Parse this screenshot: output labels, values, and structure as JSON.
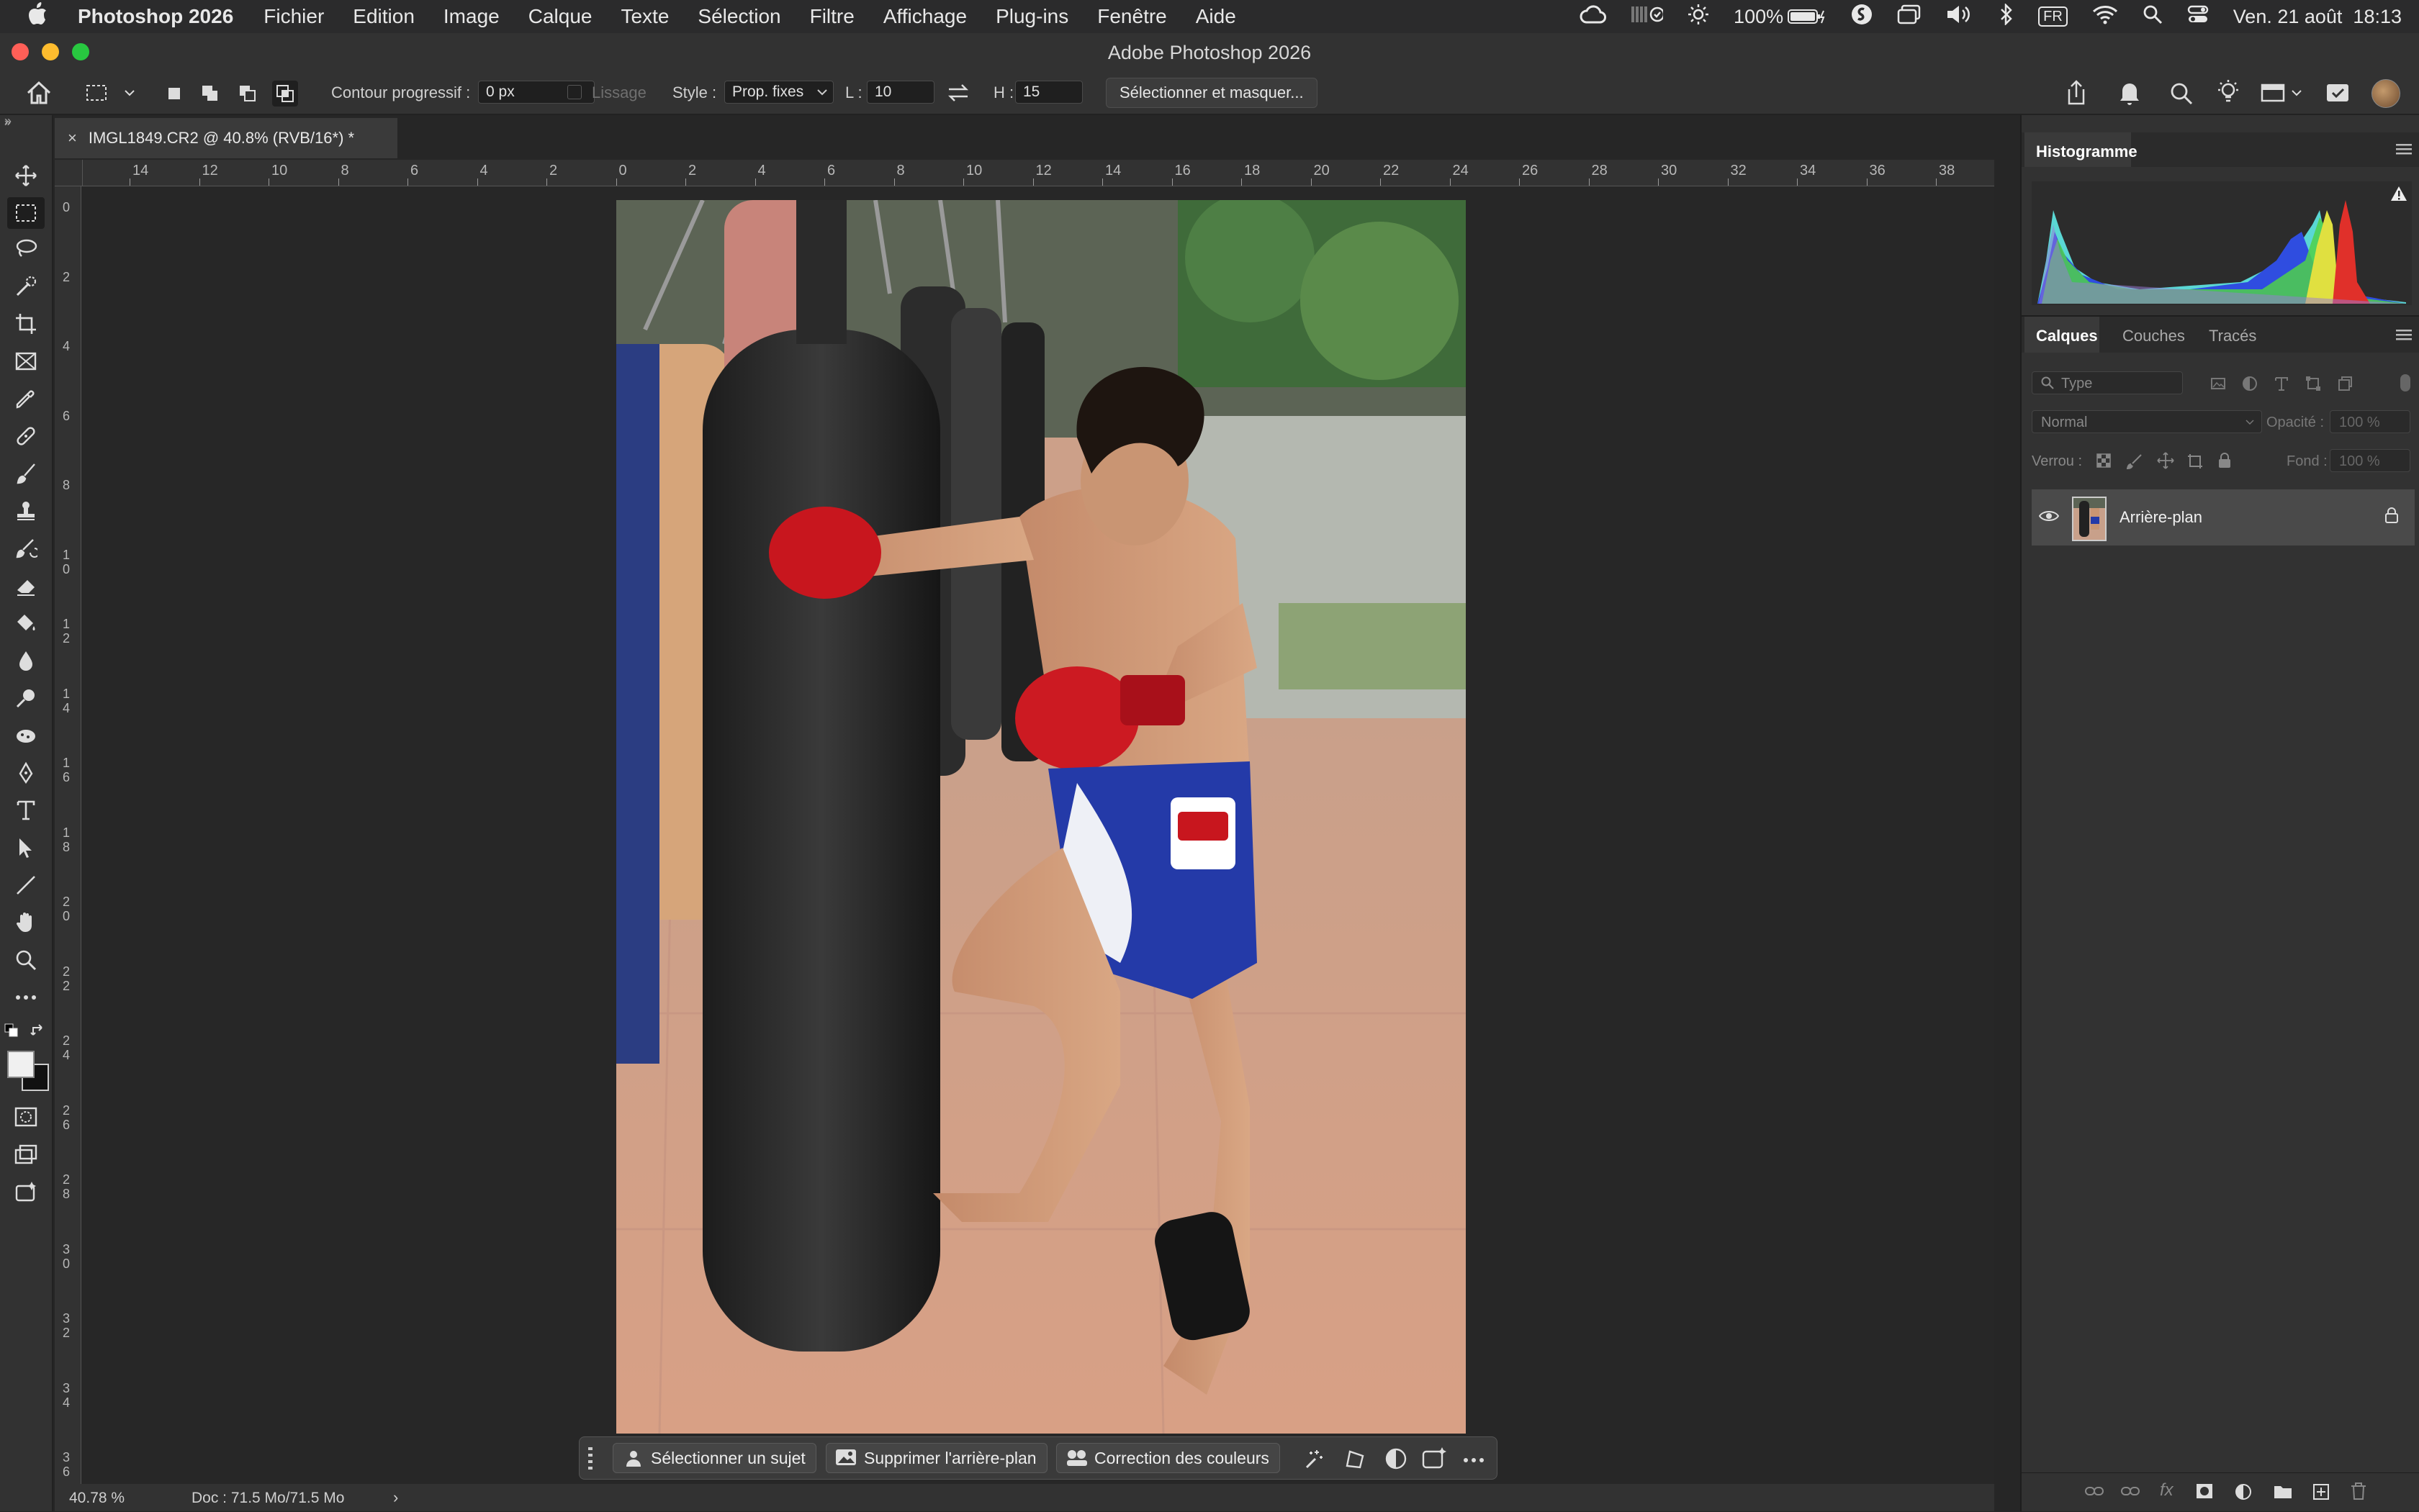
{
  "menubar": {
    "app_name": "Photoshop 2026",
    "items": [
      "Fichier",
      "Edition",
      "Image",
      "Calque",
      "Texte",
      "Sélection",
      "Filtre",
      "Affichage",
      "Plug-ins",
      "Fenêtre",
      "Aide"
    ],
    "battery": "100%",
    "input_source": "FR",
    "clock": "Ven. 21 août  18:13"
  },
  "window": {
    "title": "Adobe Photoshop 2026"
  },
  "options": {
    "feather_label": "Contour progressif :",
    "feather_value": "0 px",
    "antialias_label": "Lissage",
    "style_label": "Style :",
    "style_value": "Prop. fixes",
    "width_label": "L :",
    "width_value": "10",
    "height_label": "H :",
    "height_value": "15",
    "select_mask_label": "Sélectionner et masquer..."
  },
  "document": {
    "tab_title": "IMGL1849.CR2 @ 40.8% (RVB/16*) *",
    "zoom": "40.78 %",
    "doc_info": "Doc : 71.5 Mo/71.5 Mo"
  },
  "rulers": {
    "top_labels": [
      "14",
      "12",
      "10",
      "8",
      "6",
      "4",
      "2",
      "0",
      "2",
      "4",
      "6",
      "8",
      "10",
      "12",
      "14",
      "16",
      "18",
      "20",
      "22",
      "24",
      "26",
      "28",
      "30",
      "32",
      "34",
      "36",
      "38"
    ],
    "left_labels": [
      "0",
      "2",
      "4",
      "6",
      "8",
      "1 0",
      "1 2",
      "1 4",
      "1 6",
      "1 8",
      "2 0",
      "2 2",
      "2 4",
      "2 6",
      "2 8",
      "3 0",
      "3 2",
      "3 4",
      "3 6"
    ]
  },
  "contextbar": {
    "select_subject": "Sélectionner un sujet",
    "remove_bg": "Supprimer l'arrière-plan",
    "color_correction": "Correction des couleurs"
  },
  "panels": {
    "histogram_tab": "Histogramme",
    "tabs": [
      "Calques",
      "Couches",
      "Tracés"
    ],
    "filter_placeholder": "Type",
    "blend_mode": "Normal",
    "opacity_label": "Opacité :",
    "opacity_value": "100 %",
    "lock_label": "Verrou :",
    "fill_label": "Fond :",
    "fill_value": "100 %",
    "layer_name": "Arrière-plan"
  },
  "colors": {
    "accent": "#ff9f0a",
    "menubar_bg": "#2b2b2c",
    "panel_bg": "#323232",
    "canvas_bg": "#272727"
  }
}
